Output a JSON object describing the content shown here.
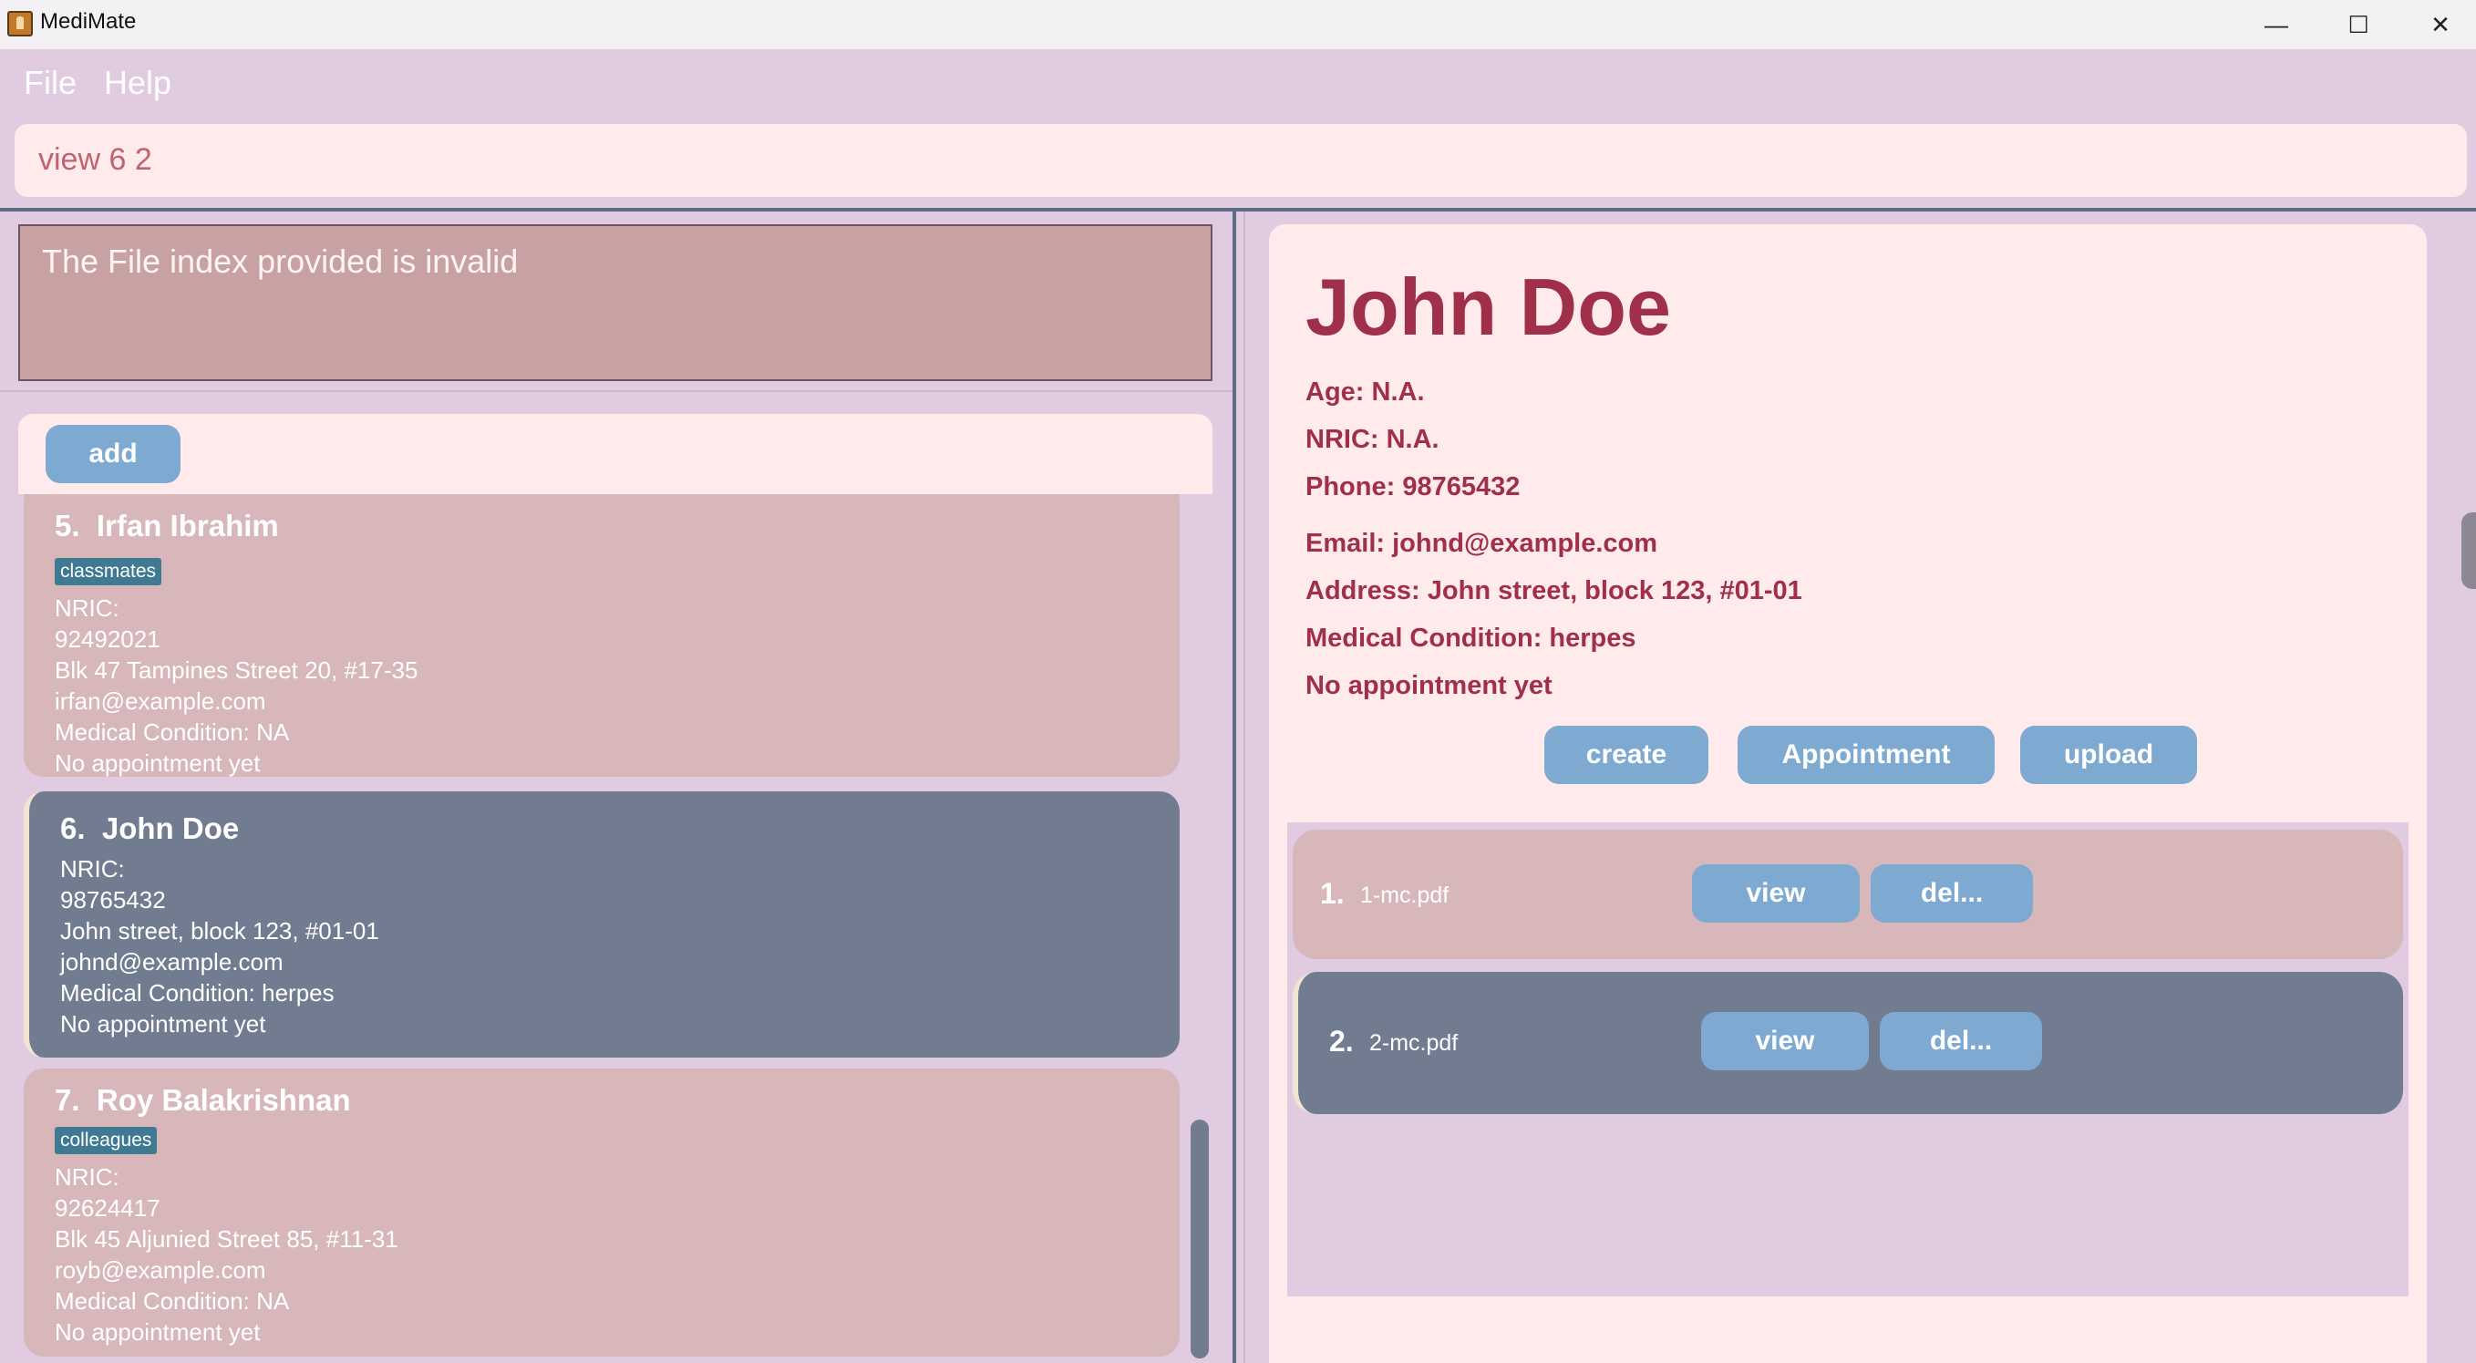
{
  "window": {
    "title": "MediMate",
    "controls": {
      "minimize": "—",
      "maximize": "☐",
      "close": "✕"
    }
  },
  "menu": {
    "items": [
      "File",
      "Help"
    ]
  },
  "command": {
    "value": "view 6 2"
  },
  "result": {
    "message": "The File index provided is invalid"
  },
  "list": {
    "add_label": "add",
    "persons": [
      {
        "index": "5.",
        "name": "Irfan Ibrahim",
        "tag": "classmates",
        "nric_label": "NRIC:",
        "phone": "92492021",
        "address": "Blk 47 Tampines Street 20, #17-35",
        "email": "irfan@example.com",
        "condition": "Medical Condition: NA",
        "appointment": "No appointment yet"
      },
      {
        "index": "6.",
        "name": "John Doe",
        "tag": "",
        "nric_label": "NRIC:",
        "phone": "98765432",
        "address": "John street, block 123, #01-01",
        "email": "johnd@example.com",
        "condition": "Medical Condition: herpes",
        "appointment": "No appointment yet"
      },
      {
        "index": "7.",
        "name": "Roy Balakrishnan",
        "tag": "colleagues",
        "nric_label": "NRIC:",
        "phone": "92624417",
        "address": "Blk 45 Aljunied Street 85, #11-31",
        "email": "royb@example.com",
        "condition": "Medical Condition: NA",
        "appointment": "No appointment yet"
      }
    ]
  },
  "detail": {
    "name": "John Doe",
    "age": "Age: N.A.",
    "nric": "NRIC: N.A.",
    "phone": "Phone: 98765432",
    "email": "Email: johnd@example.com",
    "address": "Address: John street, block 123, #01-01",
    "condition": "Medical Condition: herpes",
    "appointment": "No appointment yet",
    "buttons": {
      "create": "create",
      "appointment": "Appointment",
      "upload": "upload"
    },
    "files": [
      {
        "index": "1.",
        "name": "1-mc.pdf",
        "view": "view",
        "delete": "del..."
      },
      {
        "index": "2.",
        "name": "2-mc.pdf",
        "view": "view",
        "delete": "del..."
      }
    ]
  },
  "colors": {
    "background": "#e0cbe0",
    "card": "#d7b7b9",
    "card_selected": "#717c90",
    "button": "#7eaad2",
    "detail_text": "#a0304a",
    "tag": "#3f7a92"
  }
}
